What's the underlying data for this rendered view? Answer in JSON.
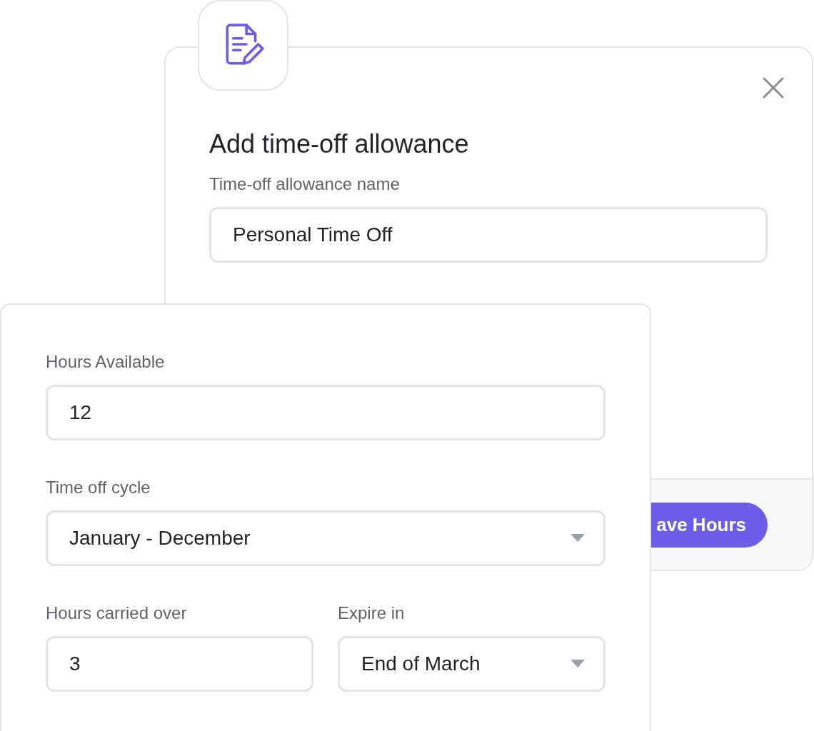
{
  "dialog": {
    "title": "Add time-off allowance",
    "fields": [
      {
        "label": "Time-off allowance name",
        "value": "Personal Time Off"
      }
    ],
    "save_button": "ave Hours"
  },
  "overlay_card": {
    "fields": [
      {
        "label": "Hours Available",
        "value": "12",
        "kind": "input"
      },
      {
        "label": "Time off cycle",
        "value": "January - December",
        "kind": "select"
      },
      {
        "label": "Hours carried over",
        "value": "3",
        "kind": "input"
      },
      {
        "label": "Expire in",
        "value": "End of March",
        "kind": "select"
      }
    ]
  }
}
